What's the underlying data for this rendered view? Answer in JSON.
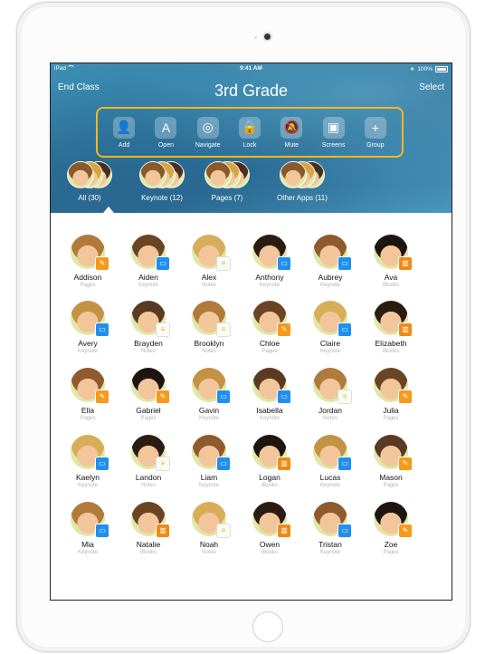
{
  "status_bar": {
    "device": "iPad",
    "time": "9:41 AM",
    "battery": "100%"
  },
  "header": {
    "end_class": "End Class",
    "title": "3rd Grade",
    "select": "Select"
  },
  "toolbar": [
    {
      "label": "Add",
      "icon": "person-add-icon",
      "glyph": "👤"
    },
    {
      "label": "Open",
      "icon": "app-store-icon",
      "glyph": "A"
    },
    {
      "label": "Navigate",
      "icon": "compass-icon",
      "glyph": "◎"
    },
    {
      "label": "Lock",
      "icon": "lock-icon",
      "glyph": "🔒"
    },
    {
      "label": "Mute",
      "icon": "mute-icon",
      "glyph": "🔕"
    },
    {
      "label": "Screens",
      "icon": "screens-icon",
      "glyph": "▣"
    },
    {
      "label": "Group",
      "icon": "plus-icon",
      "glyph": "+"
    }
  ],
  "groups": [
    {
      "label": "All (30)",
      "selected": true
    },
    {
      "label": "Keynote (12)"
    },
    {
      "label": "Pages (7)"
    },
    {
      "label": "Other Apps (11)"
    }
  ],
  "students": [
    {
      "name": "Addison",
      "app": "Pages"
    },
    {
      "name": "Aiden",
      "app": "Keynote"
    },
    {
      "name": "Alex",
      "app": "Notes"
    },
    {
      "name": "Anthony",
      "app": "Keynote"
    },
    {
      "name": "Aubrey",
      "app": "Keynote"
    },
    {
      "name": "Ava",
      "app": "iBooks"
    },
    {
      "name": "Avery",
      "app": "Keynote"
    },
    {
      "name": "Brayden",
      "app": "Notes"
    },
    {
      "name": "Brooklyn",
      "app": "Notes"
    },
    {
      "name": "Chloe",
      "app": "Pages"
    },
    {
      "name": "Claire",
      "app": "Keynote"
    },
    {
      "name": "Elizabeth",
      "app": "iBooks"
    },
    {
      "name": "Ella",
      "app": "Pages"
    },
    {
      "name": "Gabriel",
      "app": "Pages"
    },
    {
      "name": "Gavin",
      "app": "Keynote"
    },
    {
      "name": "Isabella",
      "app": "Keynote"
    },
    {
      "name": "Jordan",
      "app": "Notes"
    },
    {
      "name": "Julia",
      "app": "Pages"
    },
    {
      "name": "Kaelyn",
      "app": "Keynote"
    },
    {
      "name": "Landon",
      "app": "Notes"
    },
    {
      "name": "Liam",
      "app": "Keynote"
    },
    {
      "name": "Logan",
      "app": "iBooks"
    },
    {
      "name": "Lucas",
      "app": "Keynote"
    },
    {
      "name": "Mason",
      "app": "Pages"
    },
    {
      "name": "Mia",
      "app": "Keynote"
    },
    {
      "name": "Natalie",
      "app": "iBooks"
    },
    {
      "name": "Noah",
      "app": "Notes"
    },
    {
      "name": "Owen",
      "app": "iBooks"
    },
    {
      "name": "Tristan",
      "app": "Keynote"
    },
    {
      "name": "Zoe",
      "app": "Pages"
    }
  ],
  "colors": {
    "accent_outline": "#f2b81e",
    "header_blue": "#2e7aa2"
  }
}
